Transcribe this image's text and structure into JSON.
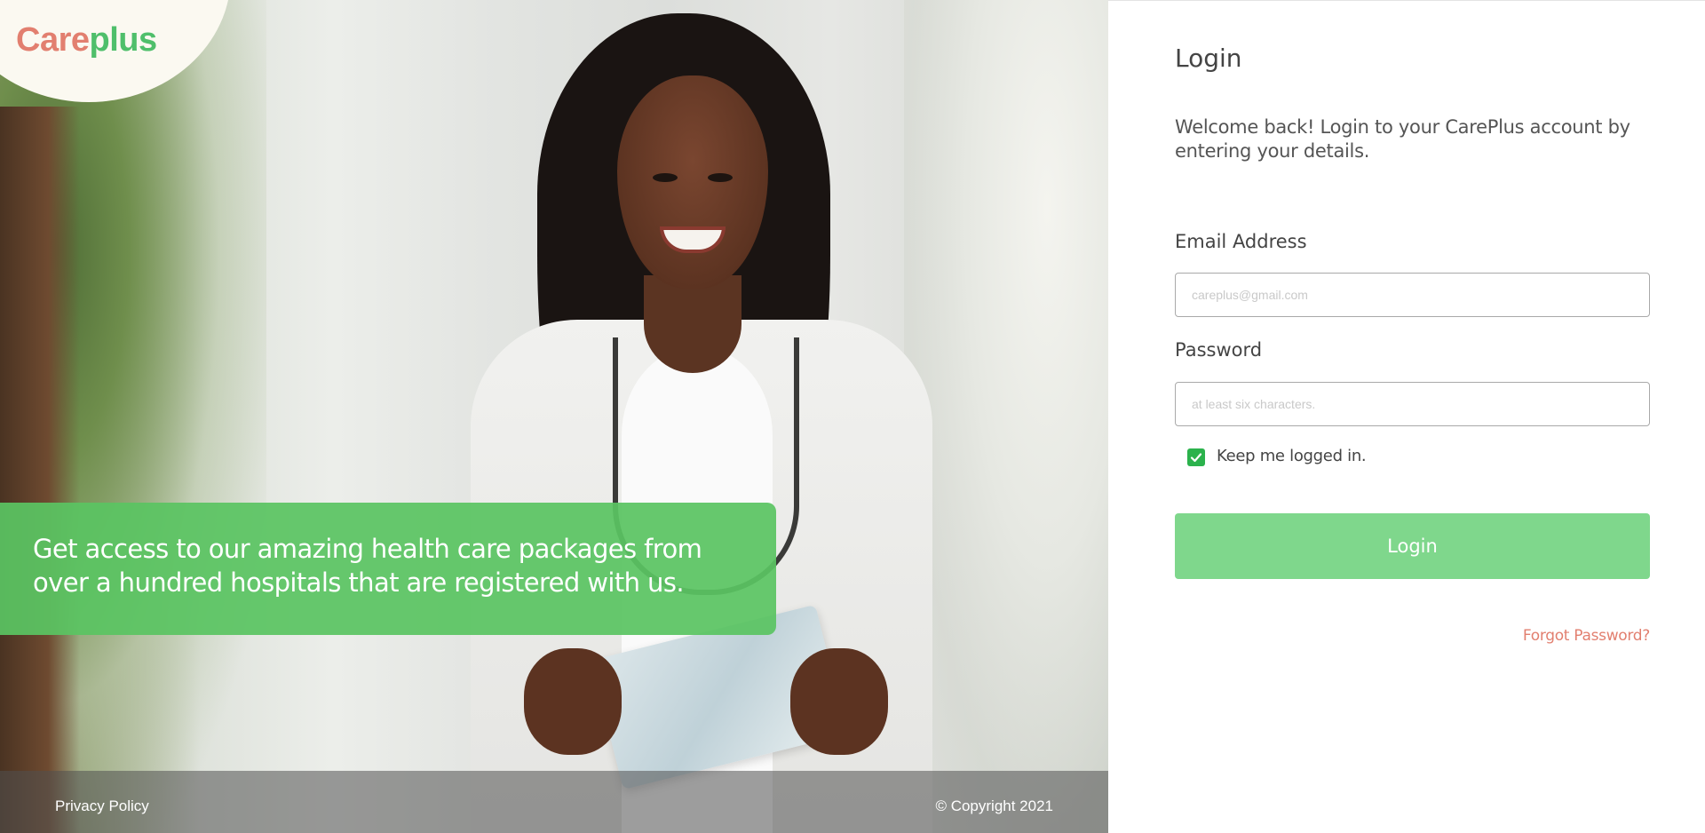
{
  "brand": {
    "logo_part1": "Care",
    "logo_part2": "plus",
    "logo_color1": "#e27f6f",
    "logo_color2": "#4fbf6b"
  },
  "hero": {
    "banner_text": "Get access to our amazing health care packages from over a hundred hospitals that are registered with us.",
    "banner_color": "#5ac462"
  },
  "footer": {
    "privacy_label": "Privacy Policy",
    "copyright": "© Copyright 2021"
  },
  "login": {
    "title": "Login",
    "subtitle": "Welcome back! Login to your CarePlus account by entering your details.",
    "email_label": "Email Address",
    "email_placeholder": "careplus@gmail.com",
    "email_value": "",
    "password_label": "Password",
    "password_placeholder": "at least six characters.",
    "password_value": "",
    "keep_logged_in_label": "Keep me logged in.",
    "keep_logged_in_checked": true,
    "submit_label": "Login",
    "forgot_label": "Forgot Password?",
    "accent_color": "#7fd78c"
  }
}
